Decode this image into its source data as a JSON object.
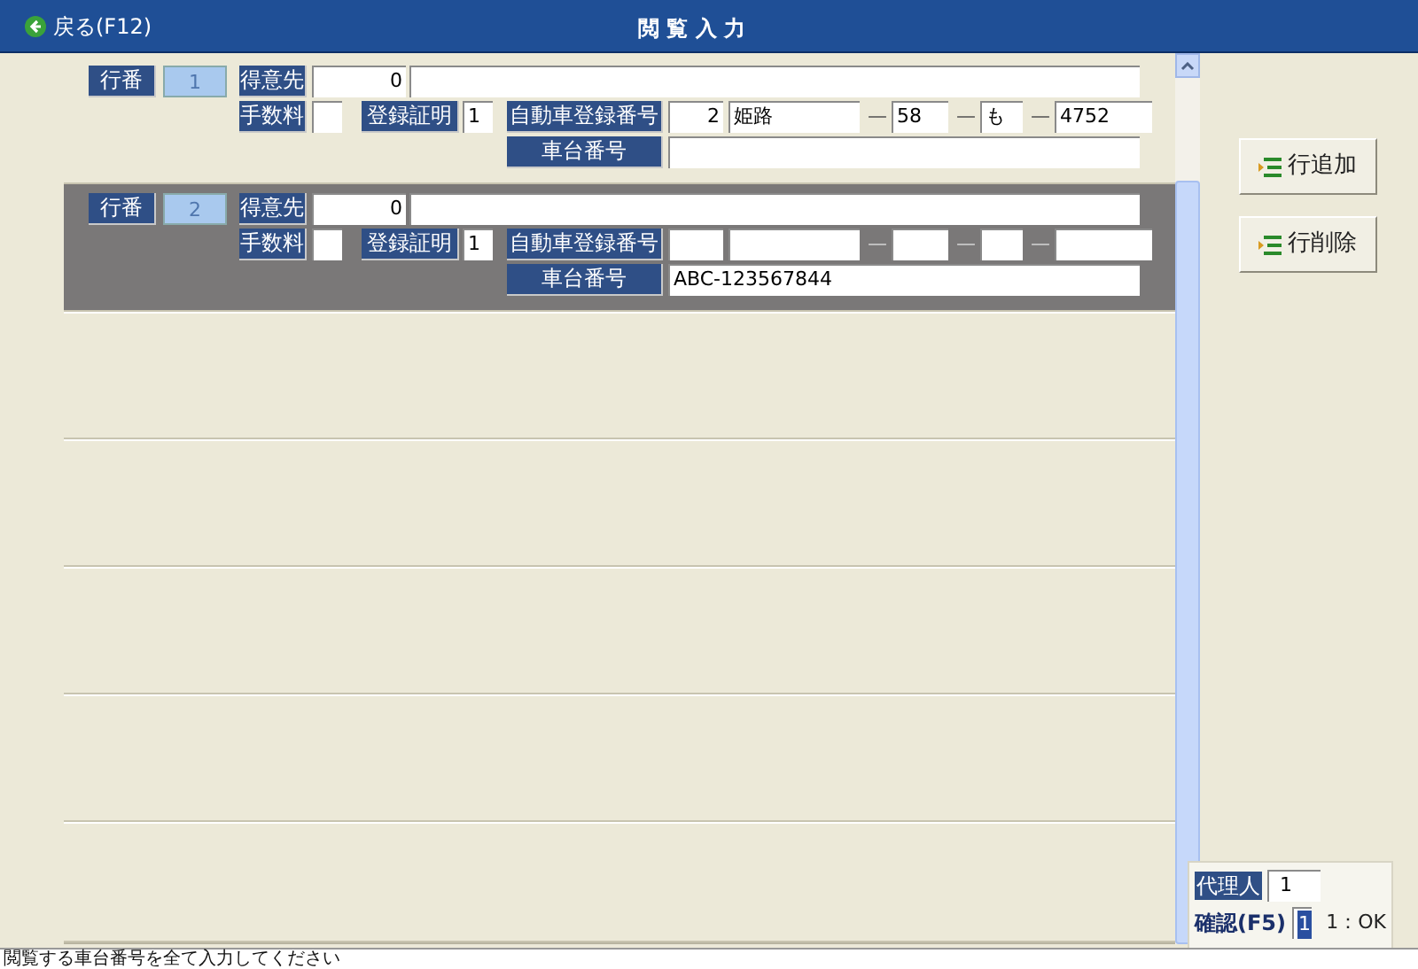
{
  "title_bar": {
    "back_button": "戻る(F12)",
    "title": "閲 覧 入 力"
  },
  "rows": [
    {
      "selected": false,
      "row_label": "行番",
      "row_no": "1",
      "customer_label": "得意先",
      "customer_code": "0",
      "fee_label": "手数料",
      "cert_label": "登録証明",
      "cert": "1",
      "reg_label": "自動車登録番号",
      "plate": [
        {
          "kind": "field",
          "value": "2"
        },
        {
          "kind": "field",
          "value": "姫路"
        },
        {
          "kind": "field",
          "sep": "—",
          "value": "58"
        },
        {
          "kind": "field",
          "sep": "—",
          "value": "も"
        },
        {
          "kind": "field",
          "sep": "—",
          "value": "4752"
        }
      ],
      "chassis_label": "車台番号"
    },
    {
      "selected": true,
      "row_label": "行番",
      "row_no": "2",
      "customer_label": "得意先",
      "customer_code": "0",
      "fee_label": "手数料",
      "cert_label": "登録証明",
      "cert": "1",
      "reg_label": "自動車登録番号",
      "plate": [
        {
          "kind": "field"
        },
        {
          "kind": "field"
        },
        {
          "kind": "field",
          "sep": "—"
        },
        {
          "kind": "field",
          "sep": "—"
        },
        {
          "kind": "field",
          "sep": "—"
        }
      ],
      "chassis_label": "車台番号",
      "chassis": "ABC-123567844"
    }
  ],
  "side_buttons": [
    {
      "label": "行追加"
    },
    {
      "label": "行削除"
    }
  ],
  "footer": {
    "agent_label": "代理人",
    "agent": "1",
    "confirm_label": "確認(F5)",
    "confirm_value": "1",
    "confirm_hint": "1：OK"
  },
  "status_bar": "閲覧する車台番号を全て入力してください"
}
